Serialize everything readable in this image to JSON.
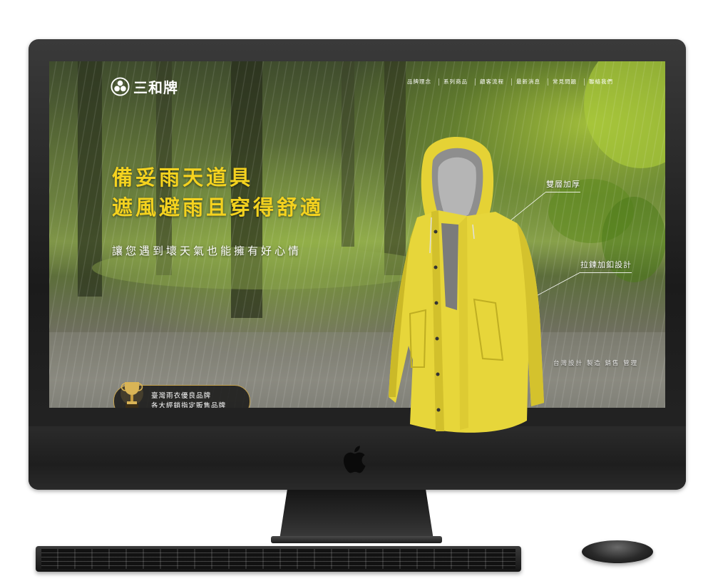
{
  "brand": {
    "name": "三和牌",
    "logo_icon": "triple-circle-logo"
  },
  "nav": {
    "items": [
      "品牌理念",
      "系列商品",
      "顧客流程",
      "最新消息",
      "常見問題",
      "聯絡我們"
    ]
  },
  "hero": {
    "headline_line1": "備妥雨天道具",
    "headline_line2": "遮風避雨且穿得舒適",
    "subheadline": "讓您遇到壞天氣也能擁有好心情"
  },
  "callouts": {
    "double_layer": "雙層加厚",
    "zipper_button": "拉鍊加釦設計",
    "made_in": "台灣設計 製造 銷售 管理"
  },
  "badge": {
    "icon": "trophy-icon",
    "line1": "臺灣雨衣優良品牌",
    "line2": "各大經銷指定販售品牌"
  },
  "colors": {
    "accent": "#f4d21f",
    "coat": "#e7d63a",
    "badge_border": "#c7a34c"
  }
}
